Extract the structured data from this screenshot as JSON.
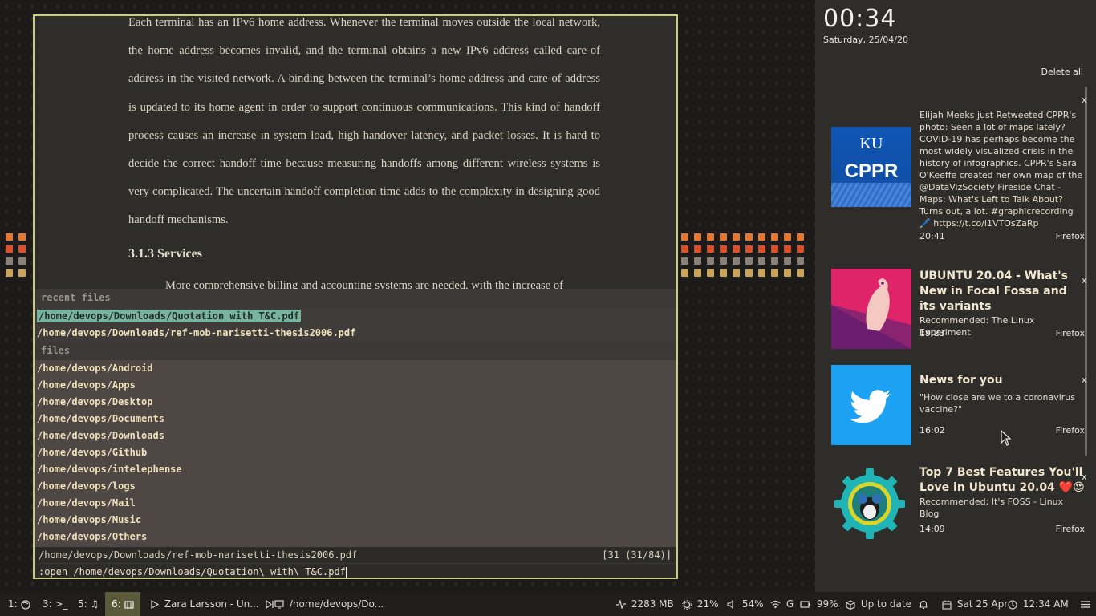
{
  "pdf": {
    "paragraph": "Each terminal has an IPv6 home address. Whenever the terminal moves outside the local network, the home address becomes invalid, and the terminal obtains a new IPv6 address called care-of address in the visited network. A binding between the terminal’s home address and care-of address is updated to its home agent in order to support continuous communications. This kind of handoff process causes an increase in system load, high handover latency, and packet losses. It is hard to decide the correct handoff time because measuring handoffs among different wireless systems is very complicated. The uncertain handoff completion time adds to the complexity in designing good handoff mechanisms.",
    "heading": "3.1.3 Services",
    "next_line": "More comprehensive billing and accounting systems are needed, with the increase of"
  },
  "completion": {
    "recent_header": "recent files",
    "recent": [
      "/home/devops/Downloads/Quotation with T&C.pdf",
      "/home/devops/Downloads/ref-mob-narisetti-thesis2006.pdf"
    ],
    "files_header": "files",
    "files": [
      "/home/devops/Android",
      "/home/devops/Apps",
      "/home/devops/Desktop",
      "/home/devops/Documents",
      "/home/devops/Downloads",
      "/home/devops/Github",
      "/home/devops/intelephense",
      "/home/devops/logs",
      "/home/devops/Mail",
      "/home/devops/Music",
      "/home/devops/Others"
    ],
    "status_path": "/home/devops/Downloads/ref-mob-narisetti-thesis2006.pdf",
    "status_count": "[31 (31/84)]",
    "command": ":open /home/devops/Downloads/Quotation\\ with\\ T&C.pdf"
  },
  "panel": {
    "clock": "00:34",
    "date": "Saturday, 25/04/20",
    "delete_all": "Delete all",
    "notifications": [
      {
        "thumb_line1": "KU",
        "thumb_line2": "CPPR",
        "title": "",
        "text": "Elijah Meeks just Retweeted CPPR's photo: Seen a lot of maps lately? COVID-19 has perhaps become the most widely visualized crisis in the history of infographics. CPPR's Sara O'Keeffe created her own map of the @DataVizSociety Fireside Chat - Maps: What's Left to Talk About? Turns out, a lot. #graphicrecording 🖊️ https://t.co/l1VTOsZaRp",
        "time": "20:41",
        "app": "Firefox",
        "close": "x"
      },
      {
        "title": "UBUNTU 20.04 - What's New in Focal Fossa and its variants",
        "text": "Recommended: The Linux Experiment",
        "time": "19:23",
        "app": "Firefox",
        "close": "x"
      },
      {
        "title": "News for you",
        "text": "\"How close are we to a coronavirus vaccine?\"",
        "time": "16:02",
        "app": "Firefox",
        "close": "x"
      },
      {
        "title": "Top 7 Best Features You'll Love in Ubuntu 20.04 ❤️😍",
        "text": "Recommended: It's FOSS - Linux Blog",
        "time": "14:09",
        "app": "Firefox",
        "close": "x"
      }
    ]
  },
  "taskbar": {
    "workspaces": [
      "1:",
      "3: >_",
      "5:",
      "6:"
    ],
    "media": "Zara Larsson - Un...",
    "window_title": "/home/devops/Do...",
    "memory": "2283 MB",
    "cpu": "21%",
    "volume": "54%",
    "wifi": "G",
    "battery": "99%",
    "updates": "Up to date",
    "date": "Sat 25 Apr",
    "time": "12:34 AM"
  },
  "colors": {
    "border_accent": "#c9cd7e",
    "selection": "#79b3a0",
    "active_workspace": "#5a5a3b"
  }
}
